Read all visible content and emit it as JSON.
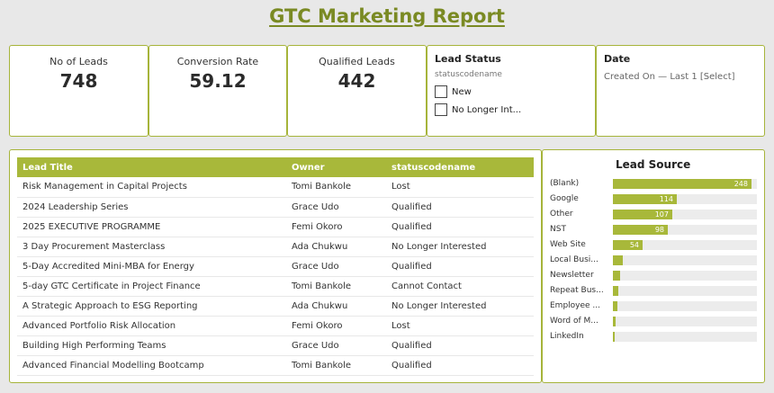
{
  "title": "GTC Marketing Report",
  "kpis": [
    {
      "label": "No of Leads",
      "value": "748"
    },
    {
      "label": "Conversion Rate",
      "value": "59.12"
    },
    {
      "label": "Qualified Leads",
      "value": "442"
    }
  ],
  "lead_status": {
    "title": "Lead Status",
    "field": "statuscodename",
    "options": [
      "New",
      "No Longer Int..."
    ]
  },
  "date_filter": {
    "title": "Date",
    "value": "Created On — Last 1 [Select]"
  },
  "table": {
    "columns": [
      "Lead Title",
      "Owner",
      "statuscodename"
    ],
    "rows": [
      [
        "Risk Management in Capital Projects",
        "Tomi Bankole",
        "Lost"
      ],
      [
        "2024 Leadership Series",
        "Grace Udo",
        "Qualified"
      ],
      [
        "2025 EXECUTIVE PROGRAMME",
        "Femi Okoro",
        "Qualified"
      ],
      [
        "3 Day Procurement Masterclass",
        "Ada Chukwu",
        "No Longer Interested"
      ],
      [
        "5-Day Accredited Mini-MBA for Energy",
        "Grace Udo",
        "Qualified"
      ],
      [
        "5-day GTC Certificate in Project Finance",
        "Tomi Bankole",
        "Cannot Contact"
      ],
      [
        "A Strategic Approach to ESG Reporting",
        "Ada Chukwu",
        "No Longer Interested"
      ],
      [
        "Advanced Portfolio Risk Allocation",
        "Femi Okoro",
        "Lost"
      ],
      [
        "Building High Performing Teams",
        "Grace Udo",
        "Qualified"
      ],
      [
        "Advanced Financial Modelling Bootcamp",
        "Tomi Bankole",
        "Qualified"
      ]
    ]
  },
  "chart_data": {
    "type": "bar",
    "title": "Lead Source",
    "categories": [
      "(Blank)",
      "Google",
      "Other",
      "NST",
      "Web Site",
      "Local Busi...",
      "Newsletter",
      "Repeat Bus...",
      "Employee ...",
      "Word of M...",
      "LinkedIn"
    ],
    "values": [
      248,
      114,
      107,
      98,
      54,
      18,
      13,
      10,
      8,
      5,
      3
    ],
    "labels": [
      "248",
      "114",
      "107",
      "98",
      "54",
      "",
      "",
      "",
      "",
      "",
      ""
    ],
    "xlim": [
      0,
      258
    ],
    "bar_color": "#a8b83a"
  },
  "colors": {
    "accent": "#a8b83a",
    "title": "#7a8a23"
  }
}
